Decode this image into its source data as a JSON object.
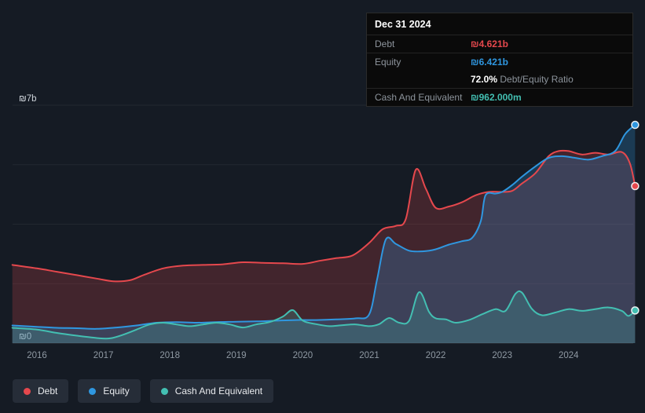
{
  "tooltip": {
    "date": "Dec 31 2024",
    "debt_label": "Debt",
    "debt_value": "₪4.621b",
    "equity_label": "Equity",
    "equity_value": "₪6.421b",
    "ratio_value": "72.0%",
    "ratio_label": "Debt/Equity Ratio",
    "cash_label": "Cash And Equivalent",
    "cash_value": "₪962.000m"
  },
  "chart_data": {
    "type": "area",
    "x_ticks": [
      2016,
      2017,
      2018,
      2019,
      2020,
      2021,
      2022,
      2023,
      2024
    ],
    "x_range": [
      2015.63,
      2025.0
    ],
    "y_axis": {
      "min": 0,
      "max": 7,
      "top_label": "₪7b",
      "bottom_label": "₪0",
      "unit": "billions ILS"
    },
    "grid": true,
    "legend_position": "bottom",
    "series": [
      {
        "name": "Debt",
        "color": "#e5484d",
        "fill": "rgba(229,72,77,0.22)",
        "last_value_label": "₪4.621b",
        "points": [
          [
            2015.63,
            2.3
          ],
          [
            2016,
            2.2
          ],
          [
            2016.3,
            2.1
          ],
          [
            2016.6,
            2.0
          ],
          [
            2016.9,
            1.9
          ],
          [
            2017.15,
            1.82
          ],
          [
            2017.4,
            1.85
          ],
          [
            2017.6,
            2.0
          ],
          [
            2017.9,
            2.2
          ],
          [
            2018.2,
            2.28
          ],
          [
            2018.5,
            2.3
          ],
          [
            2018.8,
            2.32
          ],
          [
            2019.1,
            2.38
          ],
          [
            2019.4,
            2.36
          ],
          [
            2019.7,
            2.35
          ],
          [
            2020,
            2.33
          ],
          [
            2020.25,
            2.42
          ],
          [
            2020.5,
            2.5
          ],
          [
            2020.75,
            2.58
          ],
          [
            2021,
            2.95
          ],
          [
            2021.2,
            3.35
          ],
          [
            2021.4,
            3.45
          ],
          [
            2021.55,
            3.65
          ],
          [
            2021.7,
            5.1
          ],
          [
            2021.85,
            4.55
          ],
          [
            2022,
            3.98
          ],
          [
            2022.2,
            4.02
          ],
          [
            2022.4,
            4.15
          ],
          [
            2022.6,
            4.35
          ],
          [
            2022.8,
            4.45
          ],
          [
            2023,
            4.45
          ],
          [
            2023.15,
            4.48
          ],
          [
            2023.3,
            4.7
          ],
          [
            2023.5,
            5.0
          ],
          [
            2023.7,
            5.5
          ],
          [
            2023.85,
            5.65
          ],
          [
            2024,
            5.65
          ],
          [
            2024.2,
            5.55
          ],
          [
            2024.4,
            5.6
          ],
          [
            2024.6,
            5.55
          ],
          [
            2024.8,
            5.62
          ],
          [
            2024.92,
            5.3
          ],
          [
            2025,
            4.621
          ]
        ]
      },
      {
        "name": "Equity",
        "color": "#2f97e0",
        "fill": "rgba(47,151,224,0.25)",
        "last_value_label": "₪6.421b",
        "points": [
          [
            2015.63,
            0.52
          ],
          [
            2016,
            0.48
          ],
          [
            2016.3,
            0.45
          ],
          [
            2016.6,
            0.44
          ],
          [
            2016.9,
            0.42
          ],
          [
            2017.2,
            0.46
          ],
          [
            2017.5,
            0.52
          ],
          [
            2017.8,
            0.6
          ],
          [
            2018.1,
            0.62
          ],
          [
            2018.4,
            0.6
          ],
          [
            2018.7,
            0.62
          ],
          [
            2019,
            0.63
          ],
          [
            2019.3,
            0.64
          ],
          [
            2019.6,
            0.66
          ],
          [
            2019.9,
            0.68
          ],
          [
            2020.2,
            0.68
          ],
          [
            2020.5,
            0.7
          ],
          [
            2020.8,
            0.73
          ],
          [
            2021,
            0.85
          ],
          [
            2021.12,
            1.9
          ],
          [
            2021.25,
            3.05
          ],
          [
            2021.4,
            2.92
          ],
          [
            2021.6,
            2.72
          ],
          [
            2021.8,
            2.7
          ],
          [
            2022,
            2.76
          ],
          [
            2022.2,
            2.9
          ],
          [
            2022.4,
            3.0
          ],
          [
            2022.55,
            3.1
          ],
          [
            2022.68,
            3.6
          ],
          [
            2022.75,
            4.35
          ],
          [
            2022.9,
            4.4
          ],
          [
            2023,
            4.45
          ],
          [
            2023.15,
            4.65
          ],
          [
            2023.3,
            4.9
          ],
          [
            2023.5,
            5.2
          ],
          [
            2023.7,
            5.45
          ],
          [
            2023.9,
            5.5
          ],
          [
            2024.1,
            5.45
          ],
          [
            2024.3,
            5.4
          ],
          [
            2024.5,
            5.5
          ],
          [
            2024.7,
            5.65
          ],
          [
            2024.85,
            6.15
          ],
          [
            2025,
            6.421
          ]
        ]
      },
      {
        "name": "Cash And Equivalent",
        "color": "#43bfb2",
        "fill": "rgba(67,191,178,0.22)",
        "last_value_label": "₪962.000m",
        "points": [
          [
            2015.63,
            0.45
          ],
          [
            2016,
            0.4
          ],
          [
            2016.3,
            0.3
          ],
          [
            2016.6,
            0.22
          ],
          [
            2016.9,
            0.15
          ],
          [
            2017.1,
            0.14
          ],
          [
            2017.3,
            0.25
          ],
          [
            2017.5,
            0.4
          ],
          [
            2017.7,
            0.55
          ],
          [
            2017.9,
            0.6
          ],
          [
            2018.1,
            0.55
          ],
          [
            2018.3,
            0.5
          ],
          [
            2018.5,
            0.55
          ],
          [
            2018.7,
            0.6
          ],
          [
            2018.9,
            0.55
          ],
          [
            2019.1,
            0.46
          ],
          [
            2019.3,
            0.55
          ],
          [
            2019.5,
            0.62
          ],
          [
            2019.7,
            0.78
          ],
          [
            2019.85,
            0.97
          ],
          [
            2020,
            0.66
          ],
          [
            2020.2,
            0.56
          ],
          [
            2020.4,
            0.5
          ],
          [
            2020.6,
            0.53
          ],
          [
            2020.8,
            0.55
          ],
          [
            2021,
            0.5
          ],
          [
            2021.15,
            0.56
          ],
          [
            2021.3,
            0.74
          ],
          [
            2021.45,
            0.6
          ],
          [
            2021.6,
            0.66
          ],
          [
            2021.75,
            1.5
          ],
          [
            2021.9,
            0.92
          ],
          [
            2022,
            0.73
          ],
          [
            2022.15,
            0.7
          ],
          [
            2022.3,
            0.6
          ],
          [
            2022.5,
            0.68
          ],
          [
            2022.7,
            0.85
          ],
          [
            2022.9,
            1.0
          ],
          [
            2023.05,
            0.95
          ],
          [
            2023.2,
            1.45
          ],
          [
            2023.3,
            1.48
          ],
          [
            2023.45,
            1.0
          ],
          [
            2023.6,
            0.82
          ],
          [
            2023.8,
            0.9
          ],
          [
            2024,
            1.0
          ],
          [
            2024.2,
            0.95
          ],
          [
            2024.4,
            1.0
          ],
          [
            2024.6,
            1.05
          ],
          [
            2024.8,
            0.95
          ],
          [
            2024.9,
            0.8
          ],
          [
            2025,
            0.962
          ]
        ]
      }
    ]
  }
}
